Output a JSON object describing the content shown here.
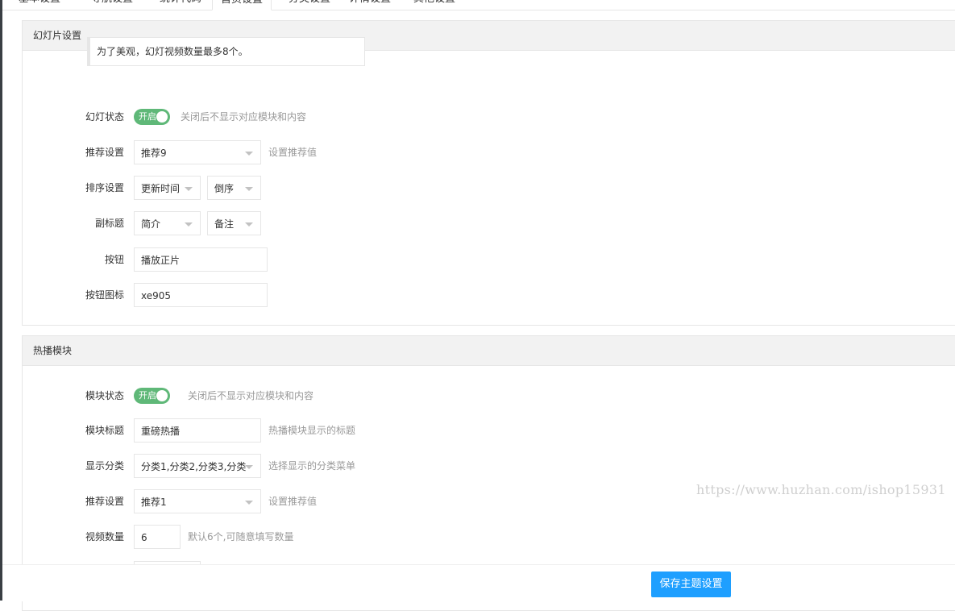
{
  "tabs": [
    {
      "label": "基本设置",
      "active": false
    },
    {
      "label": "导航设置",
      "active": false
    },
    {
      "label": "统计代码",
      "active": false
    },
    {
      "label": "首页设置",
      "active": true
    },
    {
      "label": "分类设置",
      "active": false
    },
    {
      "label": "详情设置",
      "active": false
    },
    {
      "label": "其他设置",
      "active": false
    }
  ],
  "slide": {
    "title": "幻灯片设置",
    "notice": "为了美观，幻灯视频数量最多8个。",
    "status": {
      "label": "幻灯状态",
      "switch_text": "开启",
      "hint": "关闭后不显示对应模块和内容"
    },
    "recommend": {
      "label": "推荐设置",
      "value": "推荐9",
      "hint": "设置推荐值"
    },
    "sort": {
      "label": "排序设置",
      "field": "更新时间",
      "order": "倒序"
    },
    "subtitle": {
      "label": "副标题",
      "value1": "简介",
      "value2": "备注"
    },
    "button": {
      "label": "按钮",
      "value": "播放正片"
    },
    "button_icon": {
      "label": "按钮图标",
      "value": "xe905"
    }
  },
  "hot": {
    "title": "热播模块",
    "status": {
      "label": "模块状态",
      "switch_text": "开启",
      "hint": "关闭后不显示对应模块和内容"
    },
    "module_title": {
      "label": "模块标题",
      "value": "重磅热播",
      "hint": "热播模块显示的标题"
    },
    "category": {
      "label": "显示分类",
      "value": "分类1,分类2,分类3,分类",
      "hint": "选择显示的分类菜单"
    },
    "recommend": {
      "label": "推荐设置",
      "value": "推荐1",
      "hint": "设置推荐值"
    },
    "video_count": {
      "label": "视频数量",
      "value": "6",
      "hint": "默认6个,可随意填写数量"
    }
  },
  "watermark": "https://www.huzhan.com/ishop15931",
  "save_button": "保存主题设置",
  "colors": {
    "switch_on": "#5fb878",
    "primary": "#1e9fff"
  }
}
